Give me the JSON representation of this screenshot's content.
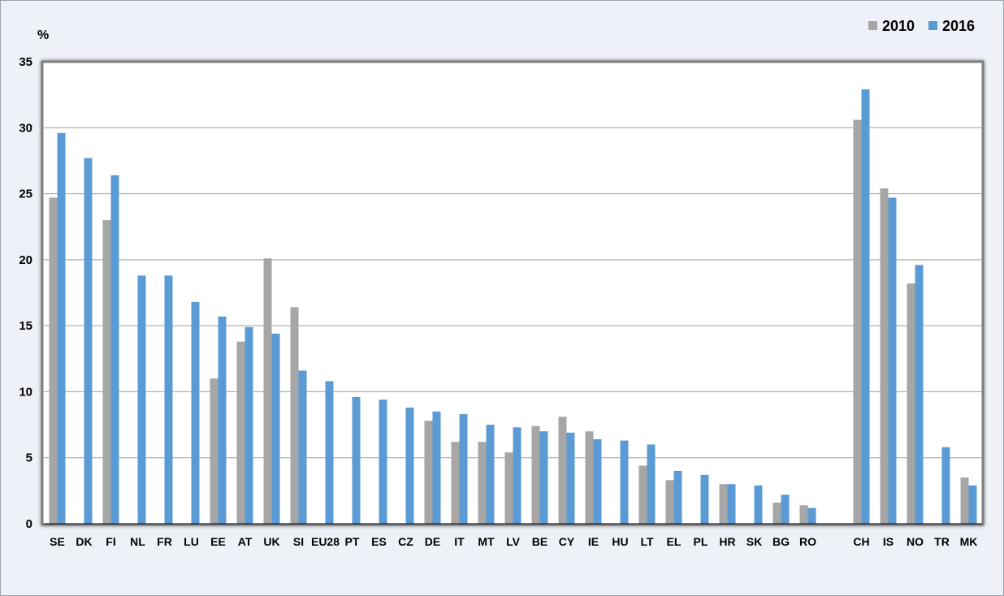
{
  "chart_data": {
    "type": "bar",
    "unit_label": "%",
    "ylim": [
      0,
      35
    ],
    "yticks": [
      "0",
      "5",
      "10",
      "15",
      "20",
      "25",
      "30",
      "35"
    ],
    "grid": true,
    "legend_position": "top-right",
    "categories": [
      "SE",
      "DK",
      "FI",
      "NL",
      "FR",
      "LU",
      "EE",
      "AT",
      "UK",
      "SI",
      "EU28",
      "PT",
      "ES",
      "CZ",
      "DE",
      "IT",
      "MT",
      "LV",
      "BE",
      "CY",
      "IE",
      "HU",
      "LT",
      "EL",
      "PL",
      "HR",
      "SK",
      "BG",
      "RO",
      "",
      "CH",
      "IS",
      "NO",
      "TR",
      "MK"
    ],
    "series": [
      {
        "name": "2010",
        "color": "#a6a6a6",
        "values": [
          24.7,
          null,
          23.0,
          null,
          null,
          null,
          11.0,
          13.8,
          20.1,
          16.4,
          null,
          null,
          null,
          null,
          7.8,
          6.2,
          6.2,
          5.4,
          7.4,
          8.1,
          7.0,
          null,
          4.4,
          3.3,
          null,
          3.0,
          null,
          1.6,
          1.4,
          null,
          30.6,
          25.4,
          18.2,
          null,
          3.5
        ]
      },
      {
        "name": "2016",
        "color": "#5b9bd5",
        "values": [
          29.6,
          27.7,
          26.4,
          18.8,
          18.8,
          16.8,
          15.7,
          14.9,
          14.4,
          11.6,
          10.8,
          9.6,
          9.4,
          8.8,
          8.5,
          8.3,
          7.5,
          7.3,
          7.0,
          6.9,
          6.4,
          6.3,
          6.0,
          4.0,
          3.7,
          3.0,
          2.9,
          2.2,
          1.2,
          null,
          32.9,
          24.7,
          19.6,
          5.8,
          2.9
        ]
      }
    ]
  }
}
